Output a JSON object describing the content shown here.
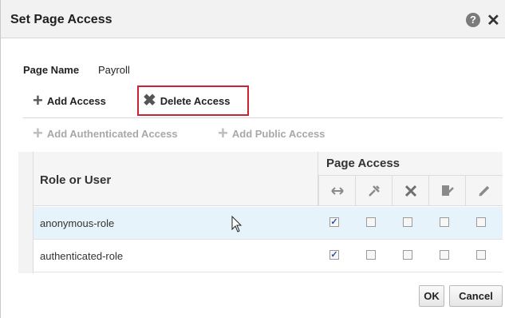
{
  "dialog": {
    "title": "Set Page Access",
    "help_icon": "?",
    "close_icon": "✕"
  },
  "page": {
    "name_label": "Page Name",
    "name_value": "Payroll"
  },
  "toolbar": {
    "add_access": "Add Access",
    "delete_access": "Delete Access",
    "add_authenticated": "Add Authenticated Access",
    "add_public": "Add Public Access"
  },
  "table": {
    "role_header": "Role or User",
    "access_header": "Page Access",
    "icons": [
      "view-icon",
      "customize-icon",
      "delete-icon",
      "edit-content-icon",
      "edit-icon"
    ],
    "rows": [
      {
        "role": "anonymous-role",
        "checked": [
          true,
          false,
          false,
          false,
          false
        ]
      },
      {
        "role": "authenticated-role",
        "checked": [
          true,
          false,
          false,
          false,
          false
        ]
      }
    ]
  },
  "buttons": {
    "ok": "OK",
    "cancel": "Cancel"
  },
  "colors": {
    "highlight_border": "#cc2233",
    "selected_row": "#e7f3fb"
  }
}
